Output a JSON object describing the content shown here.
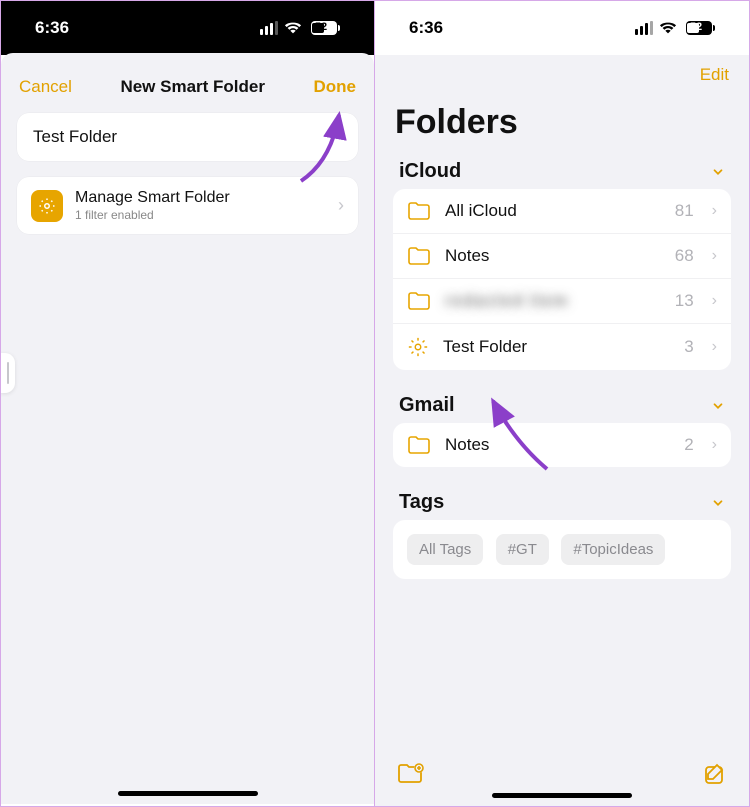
{
  "status": {
    "time": "6:36",
    "battery": "52"
  },
  "left": {
    "cancel": "Cancel",
    "title": "New Smart Folder",
    "done": "Done",
    "folder_name": "Test Folder",
    "manage_title": "Manage Smart Folder",
    "manage_sub": "1 filter enabled"
  },
  "right": {
    "edit": "Edit",
    "title": "Folders",
    "sections": {
      "icloud": {
        "header": "iCloud",
        "rows": [
          {
            "label": "All iCloud",
            "count": "81",
            "icon": "folder"
          },
          {
            "label": "Notes",
            "count": "68",
            "icon": "folder"
          },
          {
            "label": "redacted item",
            "count": "13",
            "icon": "folder",
            "blur": true
          },
          {
            "label": "Test Folder",
            "count": "3",
            "icon": "gear"
          }
        ]
      },
      "gmail": {
        "header": "Gmail",
        "rows": [
          {
            "label": "Notes",
            "count": "2",
            "icon": "folder"
          }
        ]
      },
      "tags": {
        "header": "Tags",
        "items": [
          "All Tags",
          "#GT",
          "#TopicIdeas"
        ]
      }
    }
  }
}
